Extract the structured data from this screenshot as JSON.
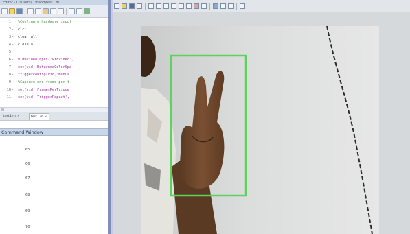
{
  "editor": {
    "title": "Editor - C:\\Users\\...\\hand\\test1.m",
    "lines": [
      {
        "num": "1",
        "dash": "",
        "text": "%Configure hardware input",
        "kind": "comment"
      },
      {
        "num": "2",
        "dash": "-",
        "text": "clc;",
        "kind": "code"
      },
      {
        "num": "3",
        "dash": "-",
        "text": "clear all;",
        "kind": "code"
      },
      {
        "num": "4",
        "dash": "-",
        "text": "close all;",
        "kind": "code"
      },
      {
        "num": "5",
        "dash": "",
        "text": "",
        "kind": "code"
      },
      {
        "num": "6",
        "dash": "-",
        "text": "vid=videoinput('winvideo',",
        "kind": "string"
      },
      {
        "num": "7",
        "dash": "-",
        "text": "set(vid,'ReturnedColorSpa",
        "kind": "string"
      },
      {
        "num": "8",
        "dash": "-",
        "text": "triggerconfig(vid,'manua",
        "kind": "string"
      },
      {
        "num": "9",
        "dash": "",
        "text": "%Capture one frame per t",
        "kind": "comment"
      },
      {
        "num": "10",
        "dash": "-",
        "text": "set(vid,'FramesPerTrigge",
        "kind": "string"
      },
      {
        "num": "11",
        "dash": "-",
        "text": "set(vid,'TriggerRepeat',",
        "kind": "string"
      }
    ],
    "tabs": [
      {
        "label": "test1.m",
        "close": "×"
      },
      {
        "label": "test1.m",
        "close": "×"
      }
    ]
  },
  "command_window": {
    "title": "Command Window",
    "lines": [
      "65",
      "66",
      "67",
      "68",
      "69",
      "70"
    ]
  },
  "figure": {
    "toolbar_icons": [
      "new-figure-icon",
      "open-icon",
      "save-icon",
      "print-icon",
      "pointer-icon",
      "zoom-in-icon",
      "zoom-out-icon",
      "pan-icon",
      "rotate-icon",
      "data-cursor-icon",
      "brush-icon",
      "link-icon",
      "colorbar-icon",
      "legend-icon",
      "grid-icon",
      "property-icon"
    ],
    "bounding_box_color": "#5fd15f"
  },
  "colors": {
    "editor_toolbar": "#e8ecf2",
    "splitter": "#7f8fb8",
    "cmd_header": "#c9d7e8",
    "comment_green": "#3a8a3a",
    "string_purple": "#a0209e"
  }
}
